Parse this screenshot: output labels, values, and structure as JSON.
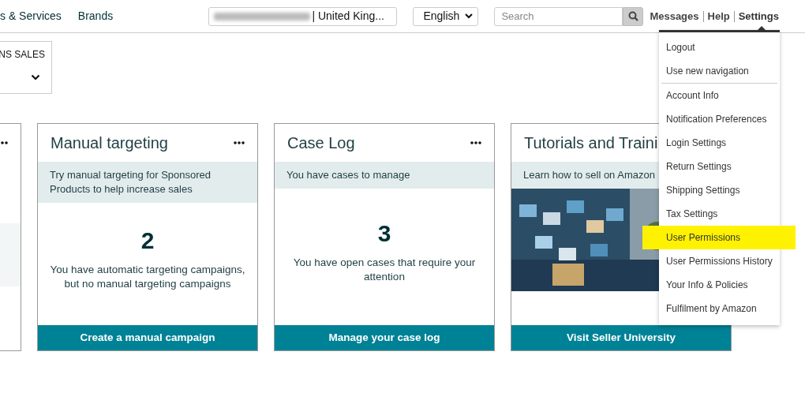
{
  "nav": {
    "links": [
      "s & Services",
      "Brands"
    ],
    "store": "| United King...",
    "language": "English",
    "search": {
      "placeholder": "Search"
    },
    "top_links": [
      {
        "label": "Messages",
        "selected": false
      },
      {
        "label": "Help",
        "selected": false
      },
      {
        "label": "Settings",
        "selected": true
      }
    ]
  },
  "filter": {
    "label": "NS SALES"
  },
  "cards": [
    {
      "kind": "partial"
    },
    {
      "kind": "count",
      "title": "Manual targeting",
      "subtitle": "Try manual targeting for Sponsored Products to help increase sales",
      "count": "2",
      "text": "You have automatic targeting campaigns, but no manual targeting campaigns",
      "action": "Create a manual campaign"
    },
    {
      "kind": "count",
      "title": "Case Log",
      "subtitle": "You have cases to manage",
      "count": "3",
      "text": "You have open cases that require your attention",
      "action": "Manage your case log"
    },
    {
      "kind": "picture",
      "title": "Tutorials and Traini",
      "subtitle": "Learn how to sell on Amazon",
      "action": "Visit Seller University"
    }
  ],
  "settings_menu": {
    "sections": [
      {
        "items": [
          {
            "label": "Logout",
            "highlighted": false
          },
          {
            "label": "Use new navigation",
            "highlighted": false
          }
        ]
      },
      {
        "items": [
          {
            "label": "Account Info",
            "highlighted": false
          },
          {
            "label": "Notification Preferences",
            "highlighted": false
          },
          {
            "label": "Login Settings",
            "highlighted": false
          },
          {
            "label": "Return Settings",
            "highlighted": false
          },
          {
            "label": "Shipping Settings",
            "highlighted": false
          },
          {
            "label": "Tax Settings",
            "highlighted": false
          },
          {
            "label": "User Permissions",
            "highlighted": true
          },
          {
            "label": "User Permissions History",
            "highlighted": false
          },
          {
            "label": "Your Info & Policies",
            "highlighted": false
          },
          {
            "label": "Fulfilment by Amazon",
            "highlighted": false
          }
        ]
      }
    ]
  }
}
